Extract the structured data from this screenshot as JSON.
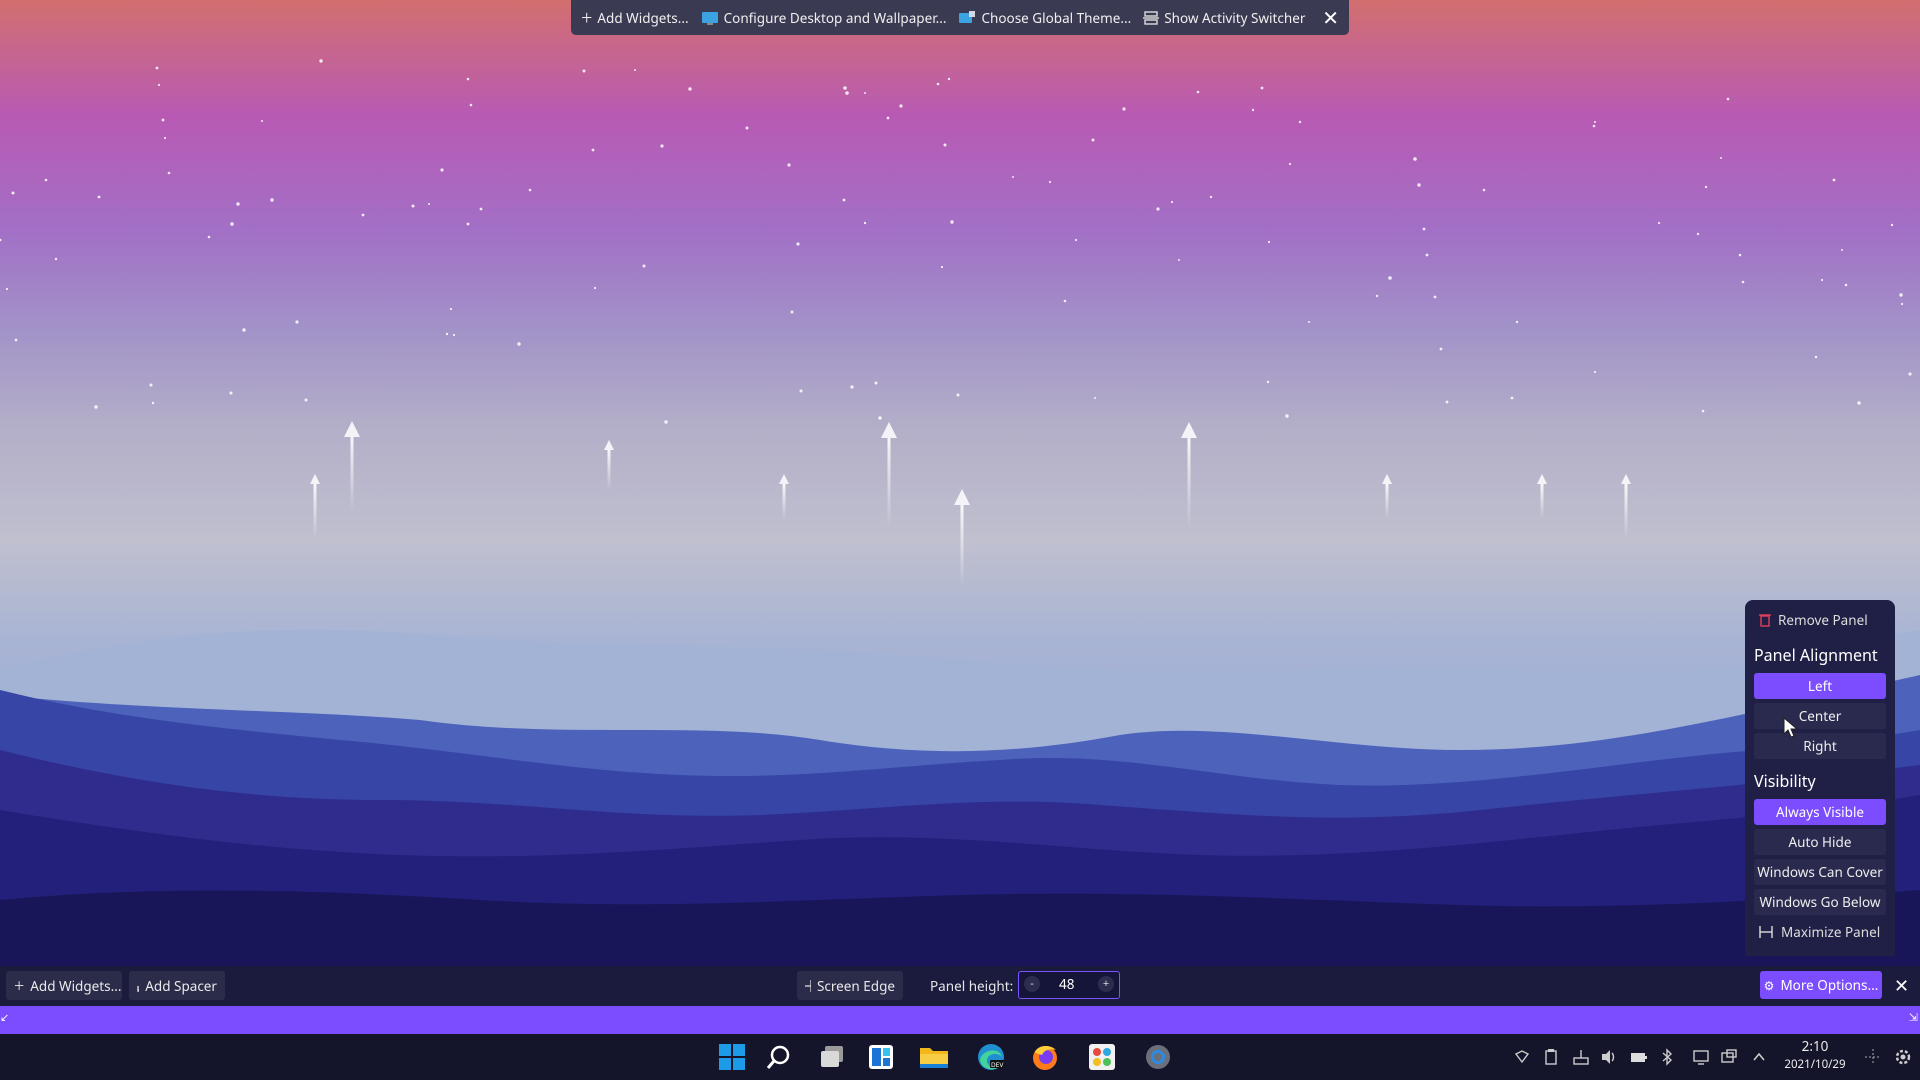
{
  "top_toolbar": {
    "add_widgets": "Add Widgets...",
    "configure_desktop": "Configure Desktop and Wallpaper...",
    "choose_theme": "Choose Global Theme...",
    "activity_switcher": "Show Activity Switcher"
  },
  "edit_bar": {
    "add_widgets": "Add Widgets...",
    "add_spacer": "Add Spacer",
    "screen_edge": "Screen Edge",
    "panel_height_label": "Panel height:",
    "panel_height_value": "48",
    "minus": "-",
    "plus": "+",
    "more_options": "More Options..."
  },
  "popup": {
    "remove_panel": "Remove Panel",
    "alignment_heading": "Panel Alignment",
    "alignment_options": [
      "Left",
      "Center",
      "Right"
    ],
    "alignment_selected": "Left",
    "visibility_heading": "Visibility",
    "visibility_options": [
      "Always Visible",
      "Auto Hide",
      "Windows Can Cover",
      "Windows Go Below"
    ],
    "visibility_selected": "Always Visible",
    "maximize_panel": "Maximize Panel"
  },
  "taskbar": {
    "apps": [
      "start-icon",
      "search-icon",
      "task-view-icon",
      "widgets-icon",
      "file-explorer-icon",
      "edge-dev-icon",
      "firefox-icon",
      "paint-app-icon",
      "settings-app-icon"
    ],
    "time": "2:10",
    "date": "2021/10/29"
  },
  "colors": {
    "accent": "#7c4dff",
    "panel_bg": "#1b1b3d",
    "popup_bg": "#201f45",
    "toolbar_bg": "#3a3a52"
  }
}
